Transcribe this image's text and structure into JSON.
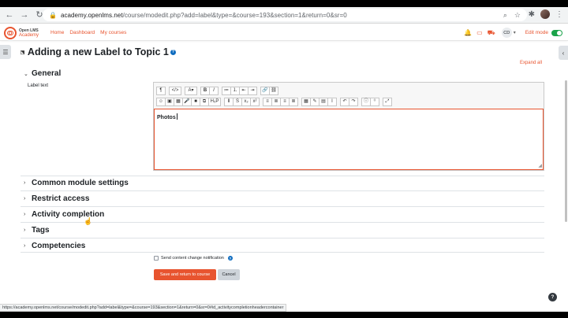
{
  "browser": {
    "url_host": "academy.openlms.net",
    "url_path": "/course/modedit.php?add=label&type=&course=193&section=1&return=0&sr=0",
    "icons": [
      "back-arrow-icon",
      "forward-arrow-icon",
      "reload-icon",
      "lock-icon",
      "search-icon",
      "star-icon",
      "extensions-icon",
      "menu-dots-icon"
    ]
  },
  "header": {
    "logo_line1": "Open LMS",
    "logo_line2": "Academy",
    "nav": [
      "Home",
      "Dashboard",
      "My courses"
    ],
    "user_initials": "CD",
    "edit_mode_label": "Edit mode",
    "edit_mode_on": true,
    "accent_color": "#e8542f"
  },
  "page": {
    "title": "Adding a new Label to Topic 1",
    "expand_all": "Expand all",
    "general_section": "General",
    "label_text_caption": "Label text",
    "editor_content": "Photos",
    "toolbar_row1": [
      "¶",
      "</>",
      "A▾",
      "B",
      "I",
      "≔",
      "⒈",
      "⇤",
      "⇥",
      "🔗",
      "⛓"
    ],
    "toolbar_row2": [
      "☺",
      "▣",
      "▦",
      "🎤",
      "■",
      "⧉",
      "H₅P",
      "Ⅱ",
      "S",
      "x₂",
      "x²",
      "≡",
      "≣",
      "≡",
      "≣",
      "▦",
      "✎",
      "▤",
      "I",
      "↶",
      "↷",
      "ⓘ",
      "⁽⁾",
      "⤢"
    ],
    "collapsed_sections": [
      "Common module settings",
      "Restrict access",
      "Activity completion",
      "Tags",
      "Competencies"
    ],
    "notify_label": "Send content change notification",
    "save_button": "Save and return to course",
    "cancel_button": "Cancel"
  },
  "status_bar": "https://academy.openlms.net/course/modedit.php?add=label&type=&course=193&section=1&return=0&sr=0#id_activitycompletionheadercontainer"
}
